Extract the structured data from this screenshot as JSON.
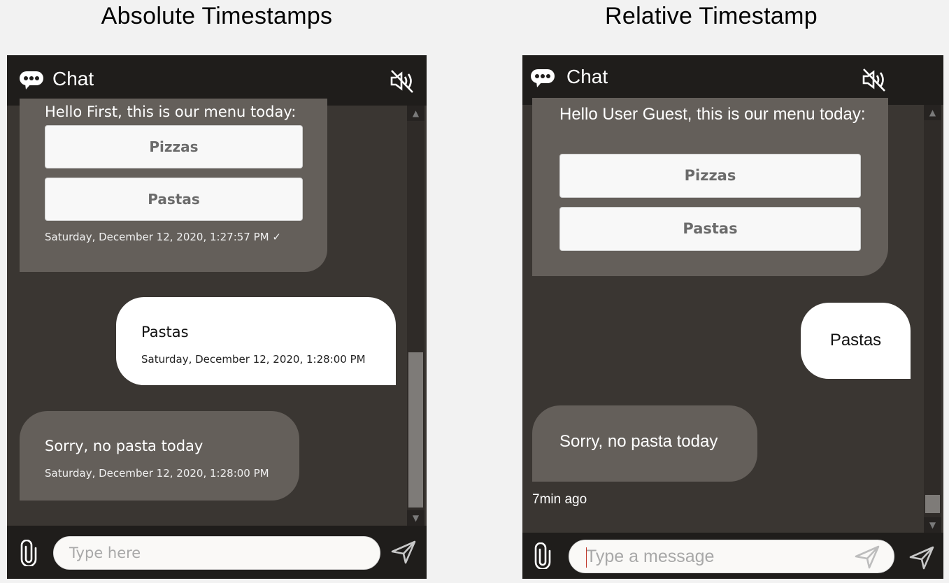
{
  "headings": {
    "left": "Absolute Timestamps",
    "right": "Relative Timestamp"
  },
  "colors": {
    "page_bg": "#f2f2f2",
    "header_bg": "#1f1d1b",
    "chat_bg": "#3a3632",
    "bot_bubble": "#645f5a",
    "user_bubble": "#ffffff",
    "option_button": "#f8f8f8",
    "option_text": "#6b6b6b"
  },
  "left_widget": {
    "header": {
      "title": "Chat",
      "logo_icon": "chat-bubble-icon",
      "mute_icon": "speaker-muted-icon"
    },
    "messages": [
      {
        "sender": "bot",
        "text": "Hello First, this is our menu today:",
        "options": [
          "Pizzas",
          "Pastas"
        ],
        "timestamp": "Saturday, December 12, 2020, 1:27:57 PM ✓"
      },
      {
        "sender": "user",
        "text": "Pastas",
        "timestamp": "Saturday, December 12, 2020, 1:28:00 PM"
      },
      {
        "sender": "bot",
        "text": "Sorry, no pasta today",
        "timestamp": "Saturday, December 12, 2020, 1:28:00 PM"
      }
    ],
    "scrollbar": {
      "position_fraction": 1.0
    },
    "footer": {
      "input_placeholder": "Type here",
      "attach_icon": "paperclip-icon",
      "send_icon": "send-icon"
    }
  },
  "right_widget": {
    "header": {
      "title": "Chat",
      "logo_icon": "chat-bubble-icon",
      "mute_icon": "speaker-muted-icon"
    },
    "messages": [
      {
        "sender": "bot",
        "text": "Hello User Guest, this is our menu today:",
        "options": [
          "Pizzas",
          "Pastas"
        ]
      },
      {
        "sender": "user",
        "text": "Pastas"
      },
      {
        "sender": "bot",
        "text": "Sorry, no pasta today"
      }
    ],
    "relative_timestamp": "7min ago",
    "scrollbar": {
      "position_fraction": 1.0
    },
    "footer": {
      "input_placeholder": "Type a message",
      "attach_icon": "paperclip-icon",
      "send_icon": "send-icon"
    }
  }
}
